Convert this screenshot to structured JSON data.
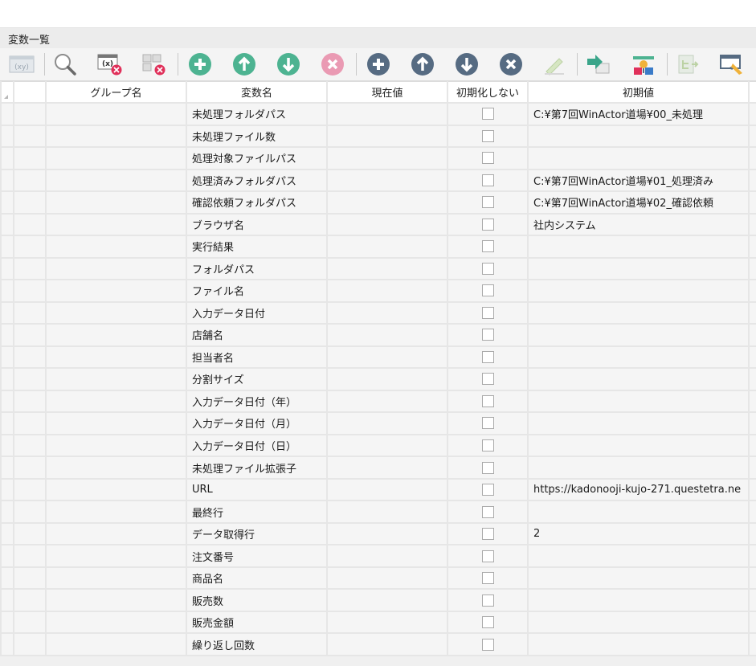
{
  "panel": {
    "title": "変数一覧"
  },
  "colors": {
    "green": "#4db391",
    "pink": "#ea9ab3",
    "navy": "#566b82",
    "badge": "#e0305a"
  },
  "toolbar": {
    "buttons": [
      {
        "name": "variable-format-icon",
        "label": "(xy)"
      },
      {
        "name": "search-icon",
        "label": ""
      },
      {
        "name": "clear-variable-icon",
        "label": "(x)"
      },
      {
        "name": "clear-group-icon",
        "label": ""
      },
      {
        "name": "add-group-icon",
        "label": ""
      },
      {
        "name": "move-group-up-icon",
        "label": ""
      },
      {
        "name": "move-group-down-icon",
        "label": ""
      },
      {
        "name": "delete-group-icon",
        "label": ""
      },
      {
        "name": "add-variable-icon",
        "label": ""
      },
      {
        "name": "move-variable-up-icon",
        "label": ""
      },
      {
        "name": "move-variable-down-icon",
        "label": ""
      },
      {
        "name": "delete-variable-icon",
        "label": ""
      },
      {
        "name": "edit-icon",
        "label": ""
      },
      {
        "name": "export-icon",
        "label": ""
      },
      {
        "name": "import-icon",
        "label": ""
      },
      {
        "name": "tree-icon",
        "label": ""
      },
      {
        "name": "pin-icon",
        "label": ""
      }
    ]
  },
  "table": {
    "headers": {
      "group": "グループ名",
      "name": "変数名",
      "current": "現在値",
      "no_init": "初期化しない",
      "initial": "初期値"
    },
    "rows": [
      {
        "name": "未処理フォルダパス",
        "current": "",
        "initial": "C:¥第7回WinActor道場¥00_未処理"
      },
      {
        "name": "未処理ファイル数",
        "current": "",
        "initial": ""
      },
      {
        "name": "処理対象ファイルパス",
        "current": "",
        "initial": ""
      },
      {
        "name": "処理済みフォルダパス",
        "current": "",
        "initial": "C:¥第7回WinActor道場¥01_処理済み"
      },
      {
        "name": "確認依頼フォルダパス",
        "current": "",
        "initial": "C:¥第7回WinActor道場¥02_確認依頼"
      },
      {
        "name": "ブラウザ名",
        "current": "",
        "initial": "社内システム"
      },
      {
        "name": "実行結果",
        "current": "",
        "initial": ""
      },
      {
        "name": "フォルダパス",
        "current": "",
        "initial": ""
      },
      {
        "name": "ファイル名",
        "current": "",
        "initial": ""
      },
      {
        "name": "入力データ日付",
        "current": "",
        "initial": ""
      },
      {
        "name": "店舗名",
        "current": "",
        "initial": ""
      },
      {
        "name": "担当者名",
        "current": "",
        "initial": ""
      },
      {
        "name": "分割サイズ",
        "current": "",
        "initial": ""
      },
      {
        "name": "入力データ日付（年）",
        "current": "",
        "initial": ""
      },
      {
        "name": "入力データ日付（月）",
        "current": "",
        "initial": ""
      },
      {
        "name": "入力データ日付（日）",
        "current": "",
        "initial": ""
      },
      {
        "name": "未処理ファイル拡張子",
        "current": "",
        "initial": ""
      },
      {
        "name": "URL",
        "current": "",
        "initial": "https://kadonooji-kujo-271.questetra.ne"
      },
      {
        "name": "最終行",
        "current": "",
        "initial": ""
      },
      {
        "name": "データ取得行",
        "current": "",
        "initial": "2"
      },
      {
        "name": "注文番号",
        "current": "",
        "initial": ""
      },
      {
        "name": "商品名",
        "current": "",
        "initial": ""
      },
      {
        "name": "販売数",
        "current": "",
        "initial": ""
      },
      {
        "name": "販売金額",
        "current": "",
        "initial": ""
      },
      {
        "name": "繰り返し回数",
        "current": "",
        "initial": ""
      }
    ]
  }
}
